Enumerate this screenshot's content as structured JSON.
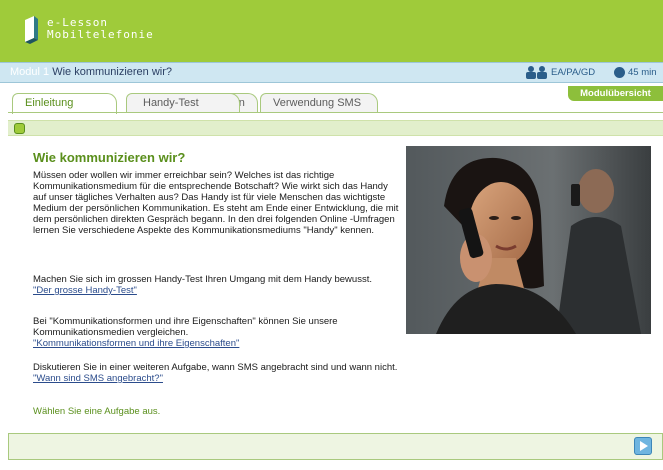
{
  "header": {
    "logo_line1": "e-Lesson",
    "logo_line2": "Mobiltelefonie",
    "brand_color": "#9fcb3a"
  },
  "module_bar": {
    "module_label": "Modul 1",
    "module_title": "Wie kommunizieren wir?",
    "social_form": "EA/PA/GD",
    "duration": "45 min",
    "icons": [
      "people-icon",
      "clock-icon"
    ]
  },
  "overview_button": "Modulübersicht",
  "tabs": [
    {
      "label": "Einleitung",
      "active": true
    },
    {
      "label": "Handy-Test",
      "active": false
    },
    {
      "label": "Kommunikation",
      "active": false
    },
    {
      "label": "Verwendung SMS",
      "active": false
    }
  ],
  "content": {
    "heading": "Wie kommunizieren wir?",
    "intro": "Müssen oder wollen wir immer erreichbar sein? Welches ist das richtige Kommunikationsmedium für die entsprechende Botschaft? Wie wirkt sich das Handy auf unser tägliches Verhalten aus? Das Handy ist für viele Menschen das wichtigste Medium der persönlichen Kommunikation. Es steht am Ende einer Entwicklung, die mit dem persönlichen direkten Gespräch begann. In den drei folgenden Online -Umfragen lernen Sie verschiedene Aspekte des Kommunikationsmediums \"Handy\" kennen.",
    "p2_text": "Machen Sie sich im grossen Handy-Test Ihren Umgang mit dem Handy bewusst.",
    "p2_link": "\"Der grosse Handy-Test\"",
    "p3_text": "Bei \"Kommunikationsformen und ihre Eigenschaften\" können Sie unsere Kommunikationsmedien vergleichen.",
    "p3_link": "\"Kommunikationsformen und ihre Eigenschaften\"",
    "p4_text": "Diskutieren Sie in einer weiteren Aufgabe, wann SMS angebracht sind und wann nicht.",
    "p4_link": "\"Wann sind SMS angebracht?\"",
    "prompt": "Wählen Sie eine Aufgabe aus."
  },
  "accent_color": "#5a8f1c",
  "link_color": "#2b4c8c"
}
